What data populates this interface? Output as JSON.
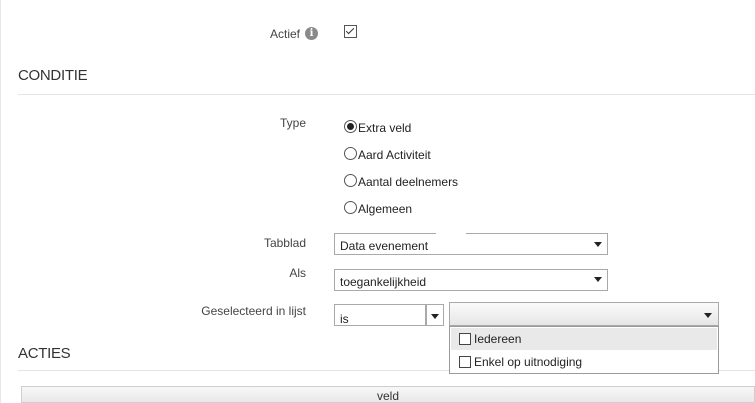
{
  "actief": {
    "label": "Actief",
    "info_icon": "info-icon",
    "checked": true
  },
  "conditie": {
    "title": "CONDITIE",
    "type_label": "Type",
    "type_options": [
      {
        "label": "Extra veld",
        "selected": true
      },
      {
        "label": "Aard Activiteit",
        "selected": false
      },
      {
        "label": "Aantal deelnemers",
        "selected": false
      },
      {
        "label": "Algemeen",
        "selected": false
      }
    ],
    "tabblad": {
      "label": "Tabblad",
      "value": "Data evenement"
    },
    "als": {
      "label": "Als",
      "value": "toegankelijkheid"
    },
    "geselecteerd": {
      "label": "Geselecteerd in lijst",
      "operator": "is",
      "value": "",
      "options": [
        {
          "label": "Iedereen",
          "checked": false,
          "hover": true
        },
        {
          "label": "Enkel op uitnodiging",
          "checked": false,
          "hover": false
        }
      ]
    }
  },
  "acties": {
    "title": "ACTIES",
    "column_header": "veld"
  }
}
